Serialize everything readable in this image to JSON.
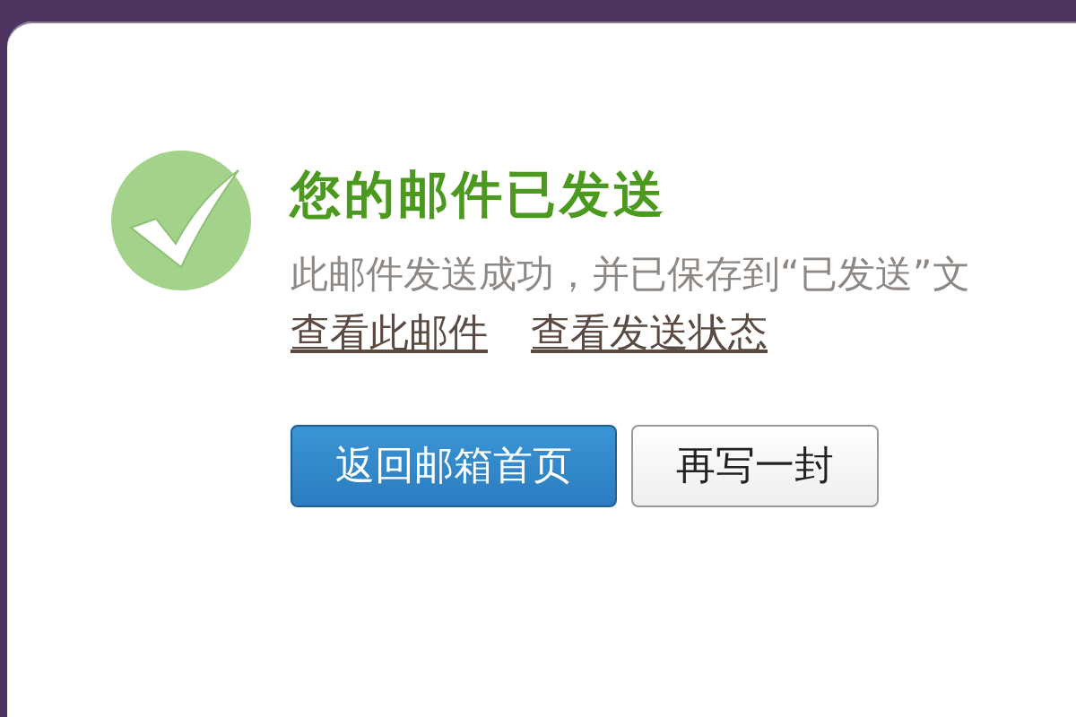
{
  "result": {
    "title": "您的邮件已发送",
    "message": "此邮件发送成功，并已保存到“已发送”文",
    "links": [
      "查看此邮件",
      "查看发送状态"
    ]
  },
  "buttons": [
    {
      "label": "返回邮箱首页",
      "kind": "primary"
    },
    {
      "label": "再写一封",
      "kind": "secondary"
    }
  ]
}
